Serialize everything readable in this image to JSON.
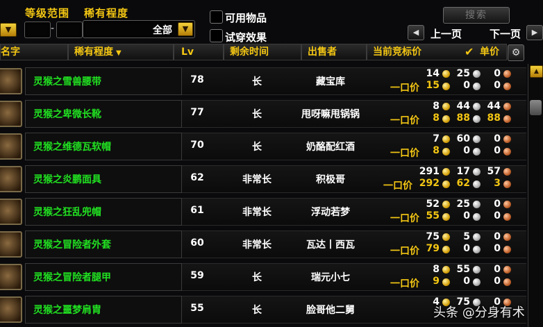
{
  "filters": {
    "level_range_label": "等级范围",
    "level_dash": "-",
    "rarity_label": "稀有程度",
    "rarity_value": "全部",
    "usable_label": "可用物品",
    "tryon_label": "试穿效果",
    "search_label": "搜索",
    "prev_label": "上一页",
    "next_label": "下一页"
  },
  "columns": {
    "name": "名字",
    "rarity": "稀有程度",
    "lv": "Lv",
    "time_left": "剩余时间",
    "seller": "出售者",
    "bid": "当前竞标价",
    "unit_price": "单价"
  },
  "buyout_label": "一口价",
  "colors": {
    "accent": "#f3c613",
    "item_green": "#21e021"
  },
  "items": [
    {
      "name": "灵猴之雪兽腰带",
      "lv": "78",
      "time": "长",
      "seller": "藏宝库",
      "bid": [
        "14",
        "25",
        "0"
      ],
      "buyout": [
        "15",
        "0",
        "0"
      ],
      "buyout_colors": [
        "gold",
        "white",
        "white"
      ]
    },
    {
      "name": "灵猴之卑微长靴",
      "lv": "77",
      "time": "长",
      "seller": "甩呀嘛甩锅锅",
      "bid": [
        "8",
        "44",
        "44"
      ],
      "buyout": [
        "8",
        "88",
        "88"
      ],
      "buyout_colors": [
        "gold",
        "gold",
        "gold"
      ]
    },
    {
      "name": "灵猴之维德瓦软帽",
      "lv": "70",
      "time": "长",
      "seller": "奶酪配红酒",
      "bid": [
        "7",
        "60",
        "0"
      ],
      "buyout": [
        "8",
        "0",
        "0"
      ],
      "buyout_colors": [
        "gold",
        "white",
        "white"
      ]
    },
    {
      "name": "灵猴之炎鹏面具",
      "lv": "62",
      "time": "非常长",
      "seller": "积极哥",
      "bid": [
        "291",
        "17",
        "57"
      ],
      "buyout": [
        "292",
        "62",
        "3"
      ],
      "buyout_colors": [
        "gold",
        "gold",
        "gold"
      ]
    },
    {
      "name": "灵猴之狂乱兜帽",
      "lv": "61",
      "time": "非常长",
      "seller": "浮动若梦",
      "bid": [
        "52",
        "25",
        "0"
      ],
      "buyout": [
        "55",
        "0",
        "0"
      ],
      "buyout_colors": [
        "gold",
        "white",
        "white"
      ]
    },
    {
      "name": "灵猴之冒险者外套",
      "lv": "60",
      "time": "非常长",
      "seller": "瓦达丨西瓦",
      "bid": [
        "75",
        "5",
        "0"
      ],
      "buyout": [
        "79",
        "0",
        "0"
      ],
      "buyout_colors": [
        "gold",
        "white",
        "white"
      ]
    },
    {
      "name": "灵猴之冒险者腿甲",
      "lv": "59",
      "time": "长",
      "seller": "瑞元小七",
      "bid": [
        "8",
        "55",
        "0"
      ],
      "buyout": [
        "9",
        "0",
        "0"
      ],
      "buyout_colors": [
        "gold",
        "white",
        "white"
      ]
    },
    {
      "name": "灵猴之噩梦肩胄",
      "lv": "55",
      "time": "长",
      "seller": "脸哥他二舅",
      "bid": [
        "4",
        "75",
        "0"
      ],
      "buyout": [],
      "buyout_colors": []
    }
  ],
  "watermark": "头条 @分身有术"
}
